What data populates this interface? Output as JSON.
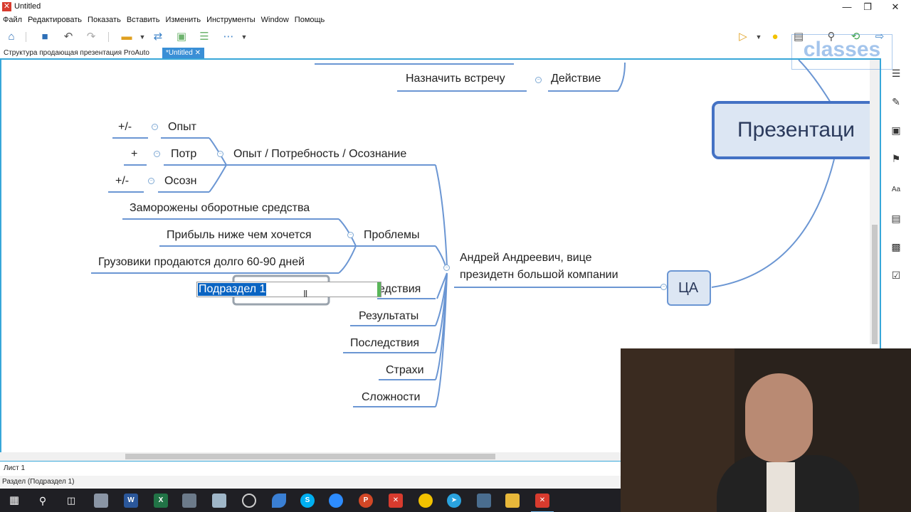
{
  "window": {
    "title": "Untitled",
    "app_icon_glyph": "✕"
  },
  "menu": [
    "Файл",
    "Редактировать",
    "Показать",
    "Вставить",
    "Изменить",
    "Инструменты",
    "Window",
    "Помощь"
  ],
  "tabs": [
    {
      "label": "Структура продающая презентация ProAuto",
      "active": false
    },
    {
      "label": "*Untitled",
      "active": true,
      "close": "✕"
    }
  ],
  "map": {
    "central": "Презентаци",
    "ca": "ЦА",
    "top_branch": {
      "action_label": "Действие",
      "child": "Назначить встречу"
    },
    "persona": {
      "line1": "Андрей Андреевич, вице",
      "line2": "президетн большой компании"
    },
    "branches": {
      "experience": {
        "label": "Опыт / Потребность / Осознание",
        "children": [
          {
            "label": "Опыт",
            "mark": "+/-"
          },
          {
            "label": "Потр",
            "mark": "+"
          },
          {
            "label": "Осозн",
            "mark": "+/-"
          }
        ]
      },
      "problems": {
        "label": "Проблемы",
        "children": [
          "Заморожены оборотные средства",
          "Прибыль ниже чем хочется",
          "Грузовики продаются долго 60-90 дней"
        ]
      },
      "consequences_partial": "едствия",
      "others": [
        "Результаты",
        "Последствия",
        "Страхи",
        "Сложности"
      ]
    },
    "editing_value": "Подраздел 1"
  },
  "sheet": "Лист 1",
  "status": "Раздел (Подраздел 1)",
  "watermark": "classes",
  "colors": {
    "accent": "#38a7d9",
    "central_border": "#4472c4",
    "node_fill": "#dce6f3",
    "line": "#6b96d3"
  }
}
